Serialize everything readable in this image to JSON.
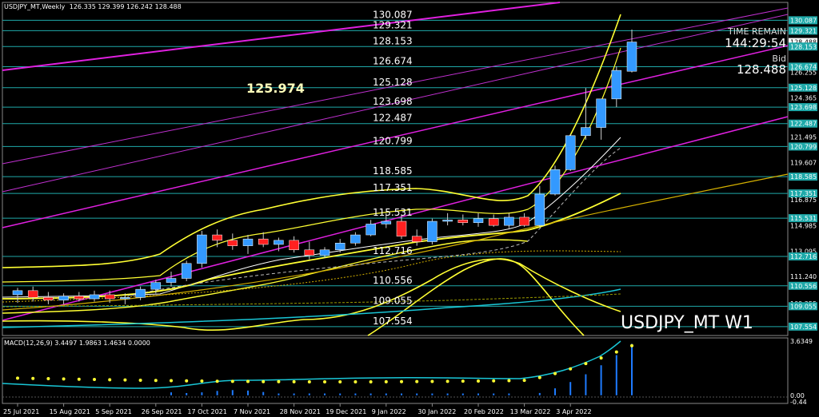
{
  "header": {
    "symbol": "USDJPY_MT,Weekly",
    "ohlc": "126.335 129.399 126.242 128.488"
  },
  "overlay": {
    "time_remain_label": "TIME REMAIN",
    "time_remain_value": "144:29:54",
    "bid_label": "Bid",
    "bid_value": "128.488",
    "highlight_value": "125.974",
    "watermark": "USDJPY_MT W1"
  },
  "colors": {
    "bull": "#3399ff",
    "bear": "#ff2020",
    "level_line": "#1fa9a9",
    "channel": "#e020e0",
    "bands": "#ffff33",
    "ma_slow": "#d4b000",
    "macd_signal": "#19c6d6",
    "macd_hist": "#1e7bff",
    "highlight_text": "#ffffbb"
  },
  "chart_data": [
    {
      "type": "candlestick",
      "title": "USDJPY_MT,Weekly",
      "ylim": [
        106.9,
        131.4
      ],
      "price_axis_ticks": [
        "130.087",
        "129.321",
        "128.488",
        "128.153",
        "126.674",
        "126.255",
        "125.128",
        "124.365",
        "123.698",
        "122.487",
        "121.495",
        "120.799",
        "119.607",
        "118.585",
        "117.351",
        "116.875",
        "115.531",
        "114.985",
        "113.095",
        "112.716",
        "111.240",
        "110.556",
        "109.255",
        "109.055",
        "107.554"
      ],
      "horizontal_levels": [
        "130.087",
        "129.321",
        "128.153",
        "126.674",
        "125.128",
        "123.698",
        "122.487",
        "120.799",
        "118.585",
        "117.351",
        "115.531",
        "112.716",
        "110.556",
        "109.055",
        "107.554"
      ],
      "x_tick_labels": [
        "25 Jul 2021",
        "15 Aug 2021",
        "5 Sep 2021",
        "26 Sep 2021",
        "17 Oct 2021",
        "7 Nov 2021",
        "28 Nov 2021",
        "19 Dec 2021",
        "9 Jan 2022",
        "30 Jan 2022",
        "20 Feb 2022",
        "13 Mar 2022",
        "3 Apr 2022"
      ],
      "candles": [
        {
          "o": 109.9,
          "h": 110.4,
          "l": 109.3,
          "c": 110.2
        },
        {
          "o": 110.2,
          "h": 110.5,
          "l": 109.4,
          "c": 109.7
        },
        {
          "o": 109.7,
          "h": 110.1,
          "l": 109.2,
          "c": 109.5
        },
        {
          "o": 109.5,
          "h": 110.0,
          "l": 109.2,
          "c": 109.8
        },
        {
          "o": 109.8,
          "h": 110.1,
          "l": 109.4,
          "c": 109.6
        },
        {
          "o": 109.6,
          "h": 110.2,
          "l": 109.4,
          "c": 109.9
        },
        {
          "o": 109.9,
          "h": 110.2,
          "l": 109.3,
          "c": 109.6
        },
        {
          "o": 109.6,
          "h": 110.0,
          "l": 109.2,
          "c": 109.7
        },
        {
          "o": 109.7,
          "h": 110.5,
          "l": 109.5,
          "c": 110.3
        },
        {
          "o": 110.3,
          "h": 111.0,
          "l": 110.0,
          "c": 110.8
        },
        {
          "o": 110.8,
          "h": 111.6,
          "l": 110.5,
          "c": 111.1
        },
        {
          "o": 111.1,
          "h": 112.4,
          "l": 110.9,
          "c": 112.2
        },
        {
          "o": 112.2,
          "h": 114.6,
          "l": 111.9,
          "c": 114.3
        },
        {
          "o": 114.3,
          "h": 114.7,
          "l": 113.4,
          "c": 113.9
        },
        {
          "o": 113.9,
          "h": 114.4,
          "l": 113.2,
          "c": 113.5
        },
        {
          "o": 113.5,
          "h": 114.3,
          "l": 112.9,
          "c": 114.0
        },
        {
          "o": 114.0,
          "h": 114.5,
          "l": 113.4,
          "c": 113.6
        },
        {
          "o": 113.6,
          "h": 114.1,
          "l": 113.1,
          "c": 113.9
        },
        {
          "o": 113.9,
          "h": 114.2,
          "l": 113.0,
          "c": 113.2
        },
        {
          "o": 113.2,
          "h": 113.8,
          "l": 112.5,
          "c": 112.8
        },
        {
          "o": 112.8,
          "h": 113.4,
          "l": 112.6,
          "c": 113.2
        },
        {
          "o": 113.2,
          "h": 114.0,
          "l": 113.0,
          "c": 113.7
        },
        {
          "o": 113.7,
          "h": 114.5,
          "l": 113.5,
          "c": 114.3
        },
        {
          "o": 114.3,
          "h": 115.4,
          "l": 114.2,
          "c": 115.1
        },
        {
          "o": 115.1,
          "h": 115.9,
          "l": 114.8,
          "c": 115.3
        },
        {
          "o": 115.3,
          "h": 115.8,
          "l": 114.0,
          "c": 114.2
        },
        {
          "o": 114.2,
          "h": 114.7,
          "l": 113.5,
          "c": 113.8
        },
        {
          "o": 113.8,
          "h": 115.5,
          "l": 113.6,
          "c": 115.3
        },
        {
          "o": 115.3,
          "h": 115.9,
          "l": 115.0,
          "c": 115.4
        },
        {
          "o": 115.4,
          "h": 115.8,
          "l": 115.0,
          "c": 115.2
        },
        {
          "o": 115.2,
          "h": 115.9,
          "l": 114.9,
          "c": 115.5
        },
        {
          "o": 115.5,
          "h": 115.8,
          "l": 114.9,
          "c": 115.0
        },
        {
          "o": 115.0,
          "h": 115.9,
          "l": 114.8,
          "c": 115.6
        },
        {
          "o": 115.6,
          "h": 115.9,
          "l": 114.9,
          "c": 115.0
        },
        {
          "o": 115.0,
          "h": 117.9,
          "l": 114.9,
          "c": 117.3
        },
        {
          "o": 117.3,
          "h": 119.4,
          "l": 117.2,
          "c": 119.1
        },
        {
          "o": 119.1,
          "h": 121.7,
          "l": 119.0,
          "c": 121.6
        },
        {
          "o": 121.6,
          "h": 125.1,
          "l": 121.3,
          "c": 122.2
        },
        {
          "o": 122.2,
          "h": 124.2,
          "l": 121.3,
          "c": 124.3
        },
        {
          "o": 124.3,
          "h": 126.7,
          "l": 123.7,
          "c": 126.4
        },
        {
          "o": 126.335,
          "h": 129.399,
          "l": 126.242,
          "c": 128.488
        }
      ]
    },
    {
      "type": "macd",
      "title": "MACD(12,26,9) 3.4497 1.9863 1.4634 0.0000",
      "params": "12,26,9",
      "values": {
        "macd": 3.4497,
        "signal": 1.9863,
        "histogram": 1.4634,
        "zero": 0.0
      },
      "ylim": [
        -0.44,
        3.6349
      ],
      "axis_ticks": [
        "3.6349",
        "0.00",
        "-0.44"
      ]
    }
  ]
}
